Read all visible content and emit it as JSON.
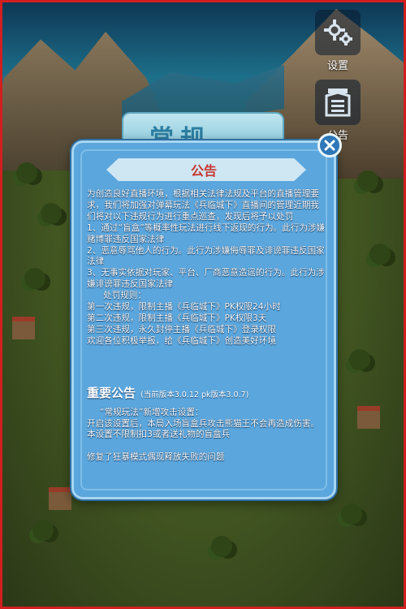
{
  "sidebar": {
    "settings": {
      "label": "设置",
      "icon": "gear-icon"
    },
    "announcement": {
      "label": "公告",
      "icon": "announcement-icon"
    }
  },
  "mode_tab": {
    "label": "常规"
  },
  "dialog": {
    "title": "公告",
    "close_icon": "close-icon",
    "paragraphs": [
      "为创造良好直播环境，根据相关法律法规及平台的直播管理要求，我们将加强对弹幕玩法《兵临城下》直播间的管理近期我们将对以下违规行为进行重点巡查，发现后将予以处罚",
      "1、通过“盲盒”等概率性玩法进行线下返现的行为。此行为涉嫌赌博罪违反国家法律",
      "2、恶意辱骂他人的行为。此行为涉嫌侮辱罪及诽谤罪违反国家法律",
      "3、无事实依据对玩家、平台、厂商恶意造谣的行为。此行为涉嫌诽谤罪违反国家法律"
    ],
    "penalty_title": "处罚规则：",
    "penalties": [
      "第一次违规，限制主播《兵临城下》PK权限24小时",
      "第二次违规，限制主播《兵临城下》PK权限3天",
      "第三次违规，永久封停主播《兵临城下》登录权限"
    ],
    "closing": "欢迎各位积极举报，给《兵临城下》创造美好环境",
    "notice_heading": "重要公告",
    "notice_version": "(当前版本3.0.12 pk版本3.0.7)",
    "update_intro": "“常规玩法”新增攻击设置：",
    "update_lines": [
      "开启该设置后，本局入场盲盒兵攻击熊猫王不会再造成伤害。",
      "本设置不限制扣3或者送礼物的盲盒兵"
    ],
    "fix_line": "修复了狂暴模式偶现释放失败的问题"
  },
  "colors": {
    "dialog_bg": "#5aa6dd",
    "title_red": "#c8362f",
    "close_bg": "#2e77b8"
  }
}
